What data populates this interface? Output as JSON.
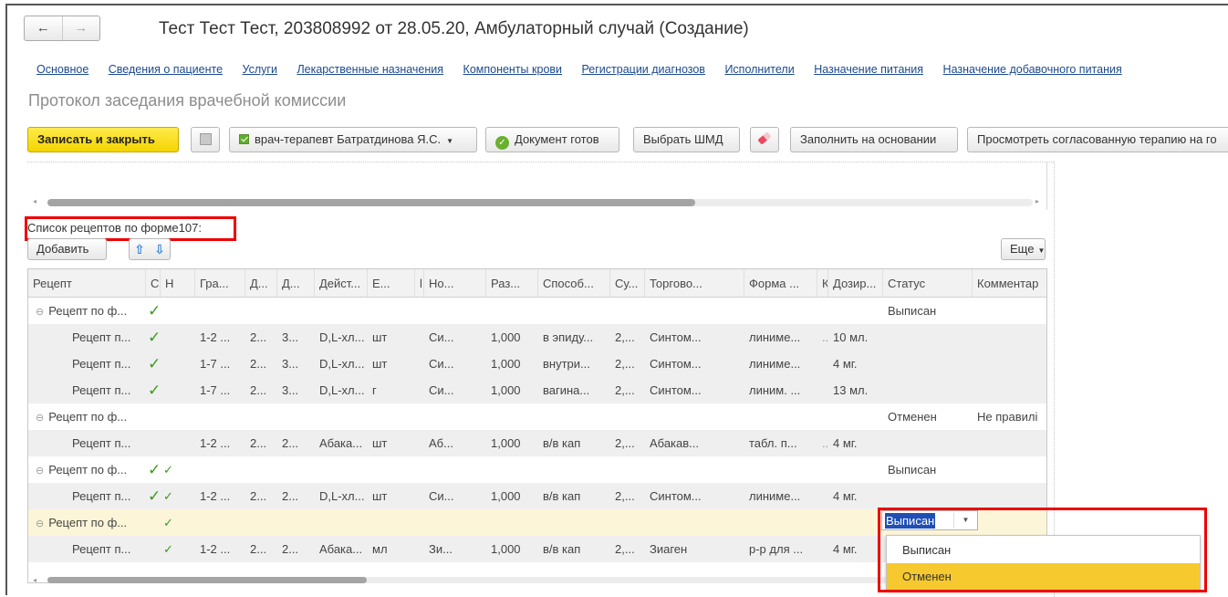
{
  "window": {
    "title": "Тест Тест Тест, 203808992 от 28.05.20, Амбулаторный случай (Создание)",
    "back_icon": "←",
    "forward_icon": "→"
  },
  "nav_links": [
    "Основное",
    "Сведения о пациенте",
    "Услуги",
    "Лекарственные назначения",
    "Компоненты крови",
    "Регистрации диагнозов",
    "Исполнители",
    "Назначение питания",
    "Назначение добавочного питания"
  ],
  "form_title": "Протокол заседания врачебной комиссии",
  "toolbar": {
    "save_close": "Записать и закрыть",
    "doctor": "врач-терапевт Батратдинова Я.С.",
    "doc_ready": "Документ готов",
    "choose_shmd": "Выбрать ШМД",
    "fill_based": "Заполнить на основании",
    "view_therapy": "Просмотреть согласованную терапию на го"
  },
  "list": {
    "label": "Список рецептов по форме107:",
    "add": "Добавить",
    "more": "Еще"
  },
  "table": {
    "headers": [
      "Рецепт",
      "С",
      "Н",
      "Гра...",
      "Д...",
      "Д...",
      "Дейст...",
      "Е...",
      "l",
      "Но...",
      "Раз...",
      "Способ...",
      "Су...",
      "Торгово...",
      "Форма ...",
      "К",
      "Дозир...",
      "Статус",
      "Комментар"
    ],
    "rows": [
      {
        "type": "group",
        "cells": [
          "Рецепт по ф...",
          "✓",
          "",
          "",
          "",
          "",
          "",
          "",
          "",
          "",
          "",
          "",
          "",
          "",
          "",
          "",
          "",
          "Выписан",
          ""
        ]
      },
      {
        "type": "child",
        "cells": [
          "Рецепт п...",
          "✓",
          "",
          "1-2 ...",
          "2...",
          "3...",
          "D,L-хл...",
          "шт",
          "",
          "Си...",
          "1,000",
          "в эпиду...",
          "2,...",
          "Синтом...",
          "линиме...",
          "...",
          "10 мл.",
          "",
          ""
        ]
      },
      {
        "type": "child",
        "cells": [
          "Рецепт п...",
          "✓",
          "",
          "1-7 ...",
          "2...",
          "3...",
          "D,L-хл...",
          "шт",
          "",
          "Си...",
          "1,000",
          "внутри...",
          "2,...",
          "Синтом...",
          "линиме...",
          "",
          "4 мг.",
          "",
          ""
        ]
      },
      {
        "type": "child",
        "cells": [
          "Рецепт п...",
          "✓",
          "",
          "1-7 ...",
          "2...",
          "3...",
          "D,L-хл...",
          "г",
          "",
          "Си...",
          "1,000",
          "вагина...",
          "2,...",
          "Синтом...",
          "линим. ...",
          "",
          "13 мл.",
          "",
          ""
        ]
      },
      {
        "type": "group",
        "cells": [
          "Рецепт по ф...",
          "",
          "",
          "",
          "",
          "",
          "",
          "",
          "",
          "",
          "",
          "",
          "",
          "",
          "",
          "",
          "",
          "Отменен",
          "Не правилі"
        ]
      },
      {
        "type": "child",
        "cells": [
          "Рецепт п...",
          "",
          "",
          "1-2 ...",
          "2...",
          "2...",
          "Абака...",
          "шт",
          "",
          "Аб...",
          "1,000",
          "в/в кап",
          "2,...",
          "Абакав...",
          "табл. п...",
          "...",
          "4 мг.",
          "",
          ""
        ]
      },
      {
        "type": "group",
        "cells": [
          "Рецепт по ф...",
          "✓",
          "✓",
          "",
          "",
          "",
          "",
          "",
          "",
          "",
          "",
          "",
          "",
          "",
          "",
          "",
          "",
          "Выписан",
          ""
        ]
      },
      {
        "type": "child",
        "cells": [
          "Рецепт п...",
          "✓",
          "✓",
          "1-2 ...",
          "2...",
          "2...",
          "D,L-хл...",
          "шт",
          "",
          "Си...",
          "1,000",
          "в/в кап",
          "2,...",
          "Синтом...",
          "линиме...",
          "",
          "4 мг.",
          "",
          ""
        ]
      },
      {
        "type": "sel",
        "cells": [
          "Рецепт по ф...",
          "",
          "✓",
          "",
          "",
          "",
          "",
          "",
          "",
          "",
          "",
          "",
          "",
          "",
          "",
          "",
          "",
          "",
          ""
        ]
      },
      {
        "type": "child",
        "cells": [
          "Рецепт п...",
          "",
          "✓",
          "1-2 ...",
          "2...",
          "2...",
          "Абака...",
          "мл",
          "",
          "Зи...",
          "1,000",
          "в/в кап",
          "2,...",
          "Зиаген",
          "р-р для ...",
          "",
          "4 мг.",
          "",
          ""
        ]
      }
    ]
  },
  "status_editor": {
    "value": "Выписан",
    "options": [
      "Выписан",
      "Отменен"
    ],
    "highlighted": "Отменен"
  },
  "colors": {
    "link": "#1c4a8c",
    "primary_button": "#f4d400",
    "check": "#3a9a1a",
    "highlight_box": "#e00000",
    "dropdown_highlight": "#f6c92e"
  }
}
